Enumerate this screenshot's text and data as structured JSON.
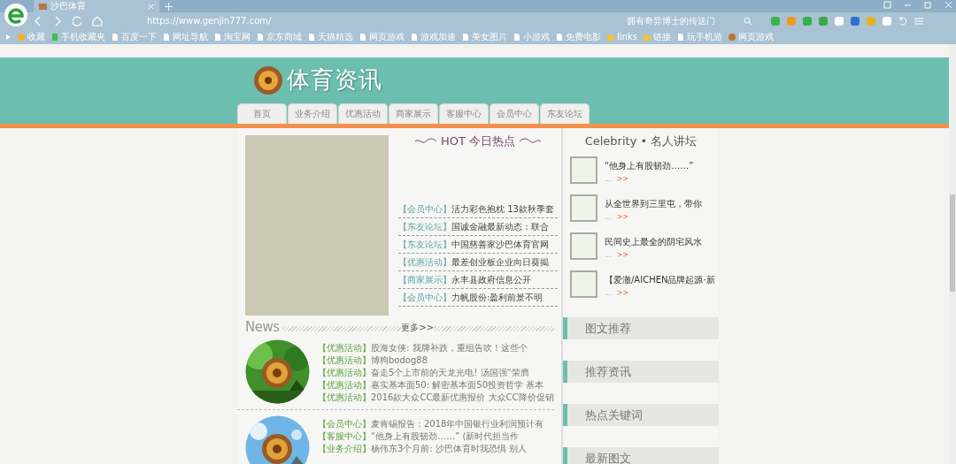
{
  "browser": {
    "tab_title": "沙巴体育",
    "url": "https://www.genjin777.com/",
    "search_placeholder": "拥有奇异博士的传送门",
    "bookmarks": [
      {
        "label": "收藏",
        "kind": "star"
      },
      {
        "label": "手机收藏夹",
        "kind": "phone"
      },
      {
        "label": "百度一下",
        "kind": "page"
      },
      {
        "label": "网址导航",
        "kind": "page"
      },
      {
        "label": "淘宝网",
        "kind": "page"
      },
      {
        "label": "京东商城",
        "kind": "page"
      },
      {
        "label": "天猫精选",
        "kind": "page"
      },
      {
        "label": "网页游戏",
        "kind": "page"
      },
      {
        "label": "游戏加速",
        "kind": "page"
      },
      {
        "label": "美女图片",
        "kind": "page"
      },
      {
        "label": "小游戏",
        "kind": "page"
      },
      {
        "label": "免费电影",
        "kind": "page"
      },
      {
        "label": "links",
        "kind": "folder"
      },
      {
        "label": "链接",
        "kind": "folder"
      },
      {
        "label": "玩手机游",
        "kind": "page"
      },
      {
        "label": "网页游戏",
        "kind": "game"
      }
    ]
  },
  "site": {
    "title": "体育资讯",
    "nav": [
      "首页",
      "业务介绍",
      "优惠活动",
      "商家展示",
      "客服中心",
      "会员中心",
      "东友论坛"
    ]
  },
  "hot": {
    "title": "HOT 今日热点",
    "items": [
      {
        "tag": "【会员中心】",
        "text": "活力彩色抱枕 13款秋季套"
      },
      {
        "tag": "【东友论坛】",
        "text": "国诚金融最新动态：联合"
      },
      {
        "tag": "【东友论坛】",
        "text": "中国慈善家沙巴体育官网"
      },
      {
        "tag": "【优惠活动】",
        "text": "最差创业板企业向日葵揭"
      },
      {
        "tag": "【商家展示】",
        "text": "永丰县政府信息公开"
      },
      {
        "tag": "【会员中心】",
        "text": "力帆股份:盈利前景不明"
      }
    ]
  },
  "celebrity": {
    "title": "Celebrity • 名人讲坛",
    "items": [
      {
        "text": "“他身上有股韧劲……”",
        "ellipsis": "...",
        "more": ">>"
      },
      {
        "text": "从全世界到三里屯，带你",
        "ellipsis": "...",
        "more": ">>"
      },
      {
        "text": "民间史上最全的阴宅风水",
        "ellipsis": "...",
        "more": ">>"
      },
      {
        "text": "【爱澈/AICHEN品牌起源·新",
        "ellipsis": "...",
        "more": ">>"
      }
    ]
  },
  "side_headings": [
    "图文推荐",
    "推荐资讯",
    "热点关键词",
    "最新图文"
  ],
  "news": {
    "title": "News",
    "more": "更多>>",
    "groups": [
      {
        "items": [
          {
            "tag": "【优惠活动】",
            "text": "股海女侠: 我牌补跌，重组告吹！这些个"
          },
          {
            "tag": "【优惠活动】",
            "text": "博狗bodog88"
          },
          {
            "tag": "【优惠活动】",
            "text": "奋走5个上市前的天龙光电! 汤国强“荣膺"
          },
          {
            "tag": "【优惠活动】",
            "text": "嘉实基本面50: 解密基本面50投资哲学 基本"
          },
          {
            "tag": "【优惠活动】",
            "text": "2016款大众CC最新优惠报价 大众CC降价促销"
          }
        ]
      },
      {
        "items": [
          {
            "tag": "【会员中心】",
            "text": "麦肯锡报告：2018年中国银行业利润预计有"
          },
          {
            "tag": "【客服中心】",
            "text": "“他身上有股韧劲……” (新时代担当作"
          },
          {
            "tag": "【业务介绍】",
            "text": "杨伟东3个月前: 沙巴体育时我恐惧 别人"
          }
        ]
      }
    ]
  }
}
